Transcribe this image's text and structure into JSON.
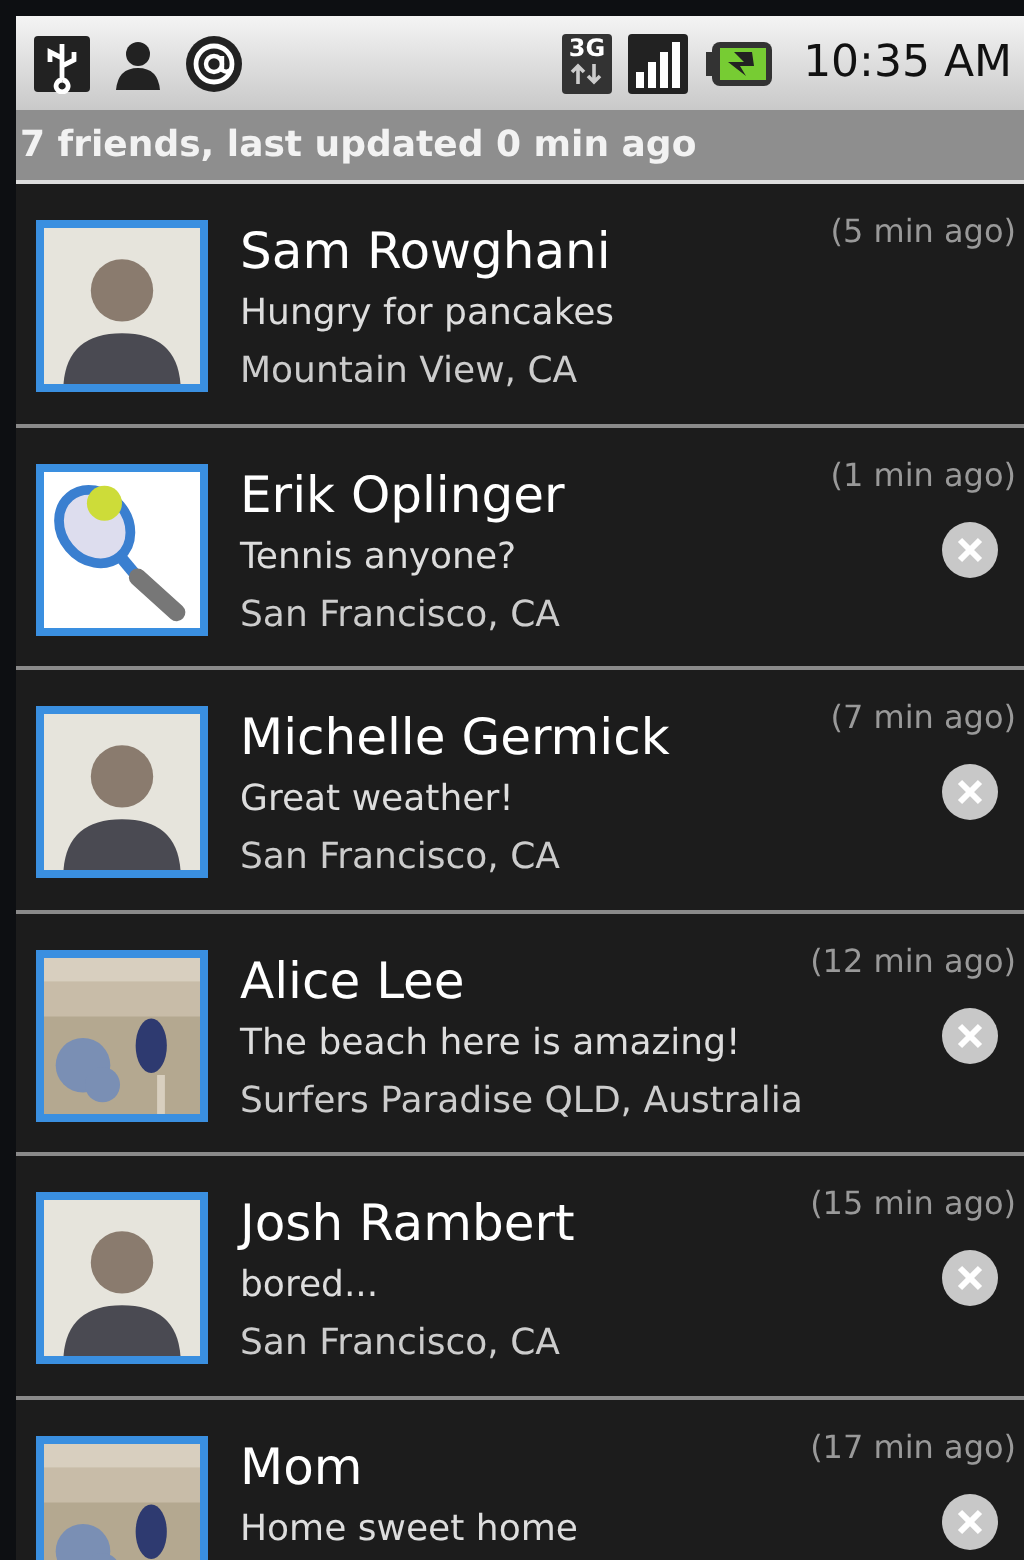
{
  "status_bar": {
    "network_label": "3G",
    "time": "10:35 AM"
  },
  "header": "7 friends, last updated 0 min ago",
  "friends": [
    {
      "name": "Sam Rowghani",
      "status": "Hungry for pancakes",
      "location": "Mountain View, CA",
      "time": "(5 min ago)",
      "removable": false,
      "kind": "person"
    },
    {
      "name": "Erik Oplinger",
      "status": "Tennis anyone?",
      "location": "San Francisco, CA",
      "time": "(1 min ago)",
      "removable": true,
      "kind": "racket"
    },
    {
      "name": "Michelle Germick",
      "status": "Great weather!",
      "location": "San Francisco, CA",
      "time": "(7 min ago)",
      "removable": true,
      "kind": "person"
    },
    {
      "name": "Alice Lee",
      "status": "The beach here is amazing!",
      "location": "Surfers Paradise QLD, Australia",
      "time": "(12 min ago)",
      "removable": true,
      "kind": "picture"
    },
    {
      "name": "Josh Rambert",
      "status": "bored...",
      "location": "San Francisco, CA",
      "time": "(15 min ago)",
      "removable": true,
      "kind": "person"
    },
    {
      "name": "Mom",
      "status": "Home sweet home",
      "time": "(17 min ago)",
      "removable": true,
      "kind": "picture"
    }
  ]
}
